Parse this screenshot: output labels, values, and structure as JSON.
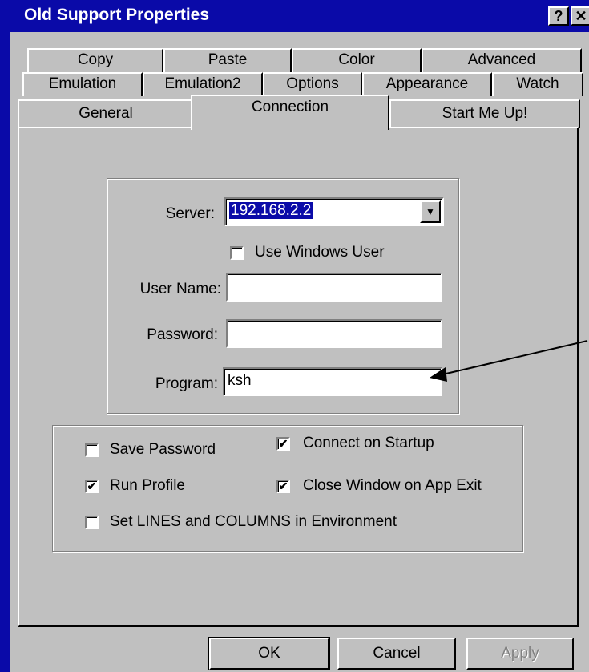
{
  "window": {
    "title": "Old Support Properties",
    "help_glyph": "?",
    "close_glyph": "✕"
  },
  "tabs": {
    "row1": [
      "Copy",
      "Paste",
      "Color",
      "Advanced"
    ],
    "row2": [
      "Emulation",
      "Emulation2",
      "Options",
      "Appearance",
      "Watch"
    ],
    "row3": [
      "General",
      "Connection",
      "Start Me Up!"
    ],
    "active": "Connection"
  },
  "connection": {
    "server_label": "Server:",
    "server_value": "192.168.2.2",
    "use_windows_user_label": "Use Windows User",
    "use_windows_user_checked": false,
    "username_label": "User Name:",
    "username_value": "",
    "password_label": "Password:",
    "password_value": "",
    "program_label": "Program:",
    "program_value": "ksh"
  },
  "options": {
    "save_password": {
      "label": "Save Password",
      "checked": false
    },
    "connect_on_startup": {
      "label": "Connect on Startup",
      "checked": true
    },
    "run_profile": {
      "label": "Run Profile",
      "checked": true
    },
    "close_window": {
      "label": "Close Window on App Exit",
      "checked": true
    },
    "set_lines": {
      "label": "Set LINES and COLUMNS in Environment",
      "checked": false
    }
  },
  "buttons": {
    "ok": "OK",
    "cancel": "Cancel",
    "apply": "Apply"
  },
  "colors": {
    "titlebar": "#0a0aa8",
    "face": "#c0c0c0",
    "annotation_arrow": "#000000"
  }
}
